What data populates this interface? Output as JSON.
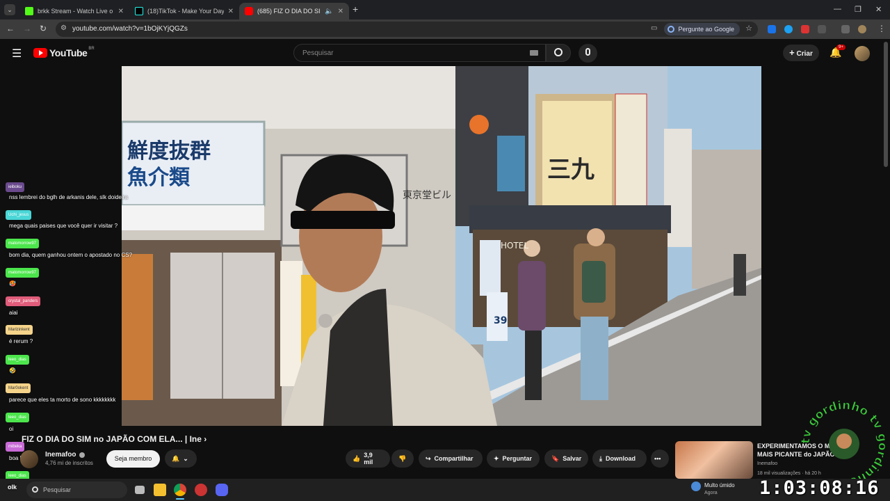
{
  "browser": {
    "tabs": [
      {
        "label": "brkk Stream - Watch Live o",
        "favicon_color": "#53fc18",
        "active": false
      },
      {
        "label": "(18)TikTok - Make Your Day",
        "favicon_color": "#000000",
        "active": false
      },
      {
        "label": "(685) FIZ O DIA DO SIM no",
        "favicon_color": "#ff0000",
        "active": true
      }
    ],
    "new_tab": "+",
    "window_controls": [
      "—",
      "❐",
      "✕"
    ],
    "url": "youtube.com/watch?v=1bOjKYjQGZs",
    "ask_google": "Pergunte ao Google"
  },
  "youtube": {
    "logo_text": "YouTube",
    "region": "BR",
    "search_placeholder": "Pesquisar",
    "create_label": "Criar",
    "notifications": "9+"
  },
  "chat": [
    {
      "user": "ieiboku",
      "color": "#6a4a8c",
      "msg": "nss lembrei do bglh de arkanis dele, slk doideira"
    },
    {
      "user": "Uchi_jesus",
      "color": "#4ad6d6",
      "msg": "mega quais paises que você quer ir visitar ?"
    },
    {
      "user": "matomorrow97",
      "color": "#4ce64c",
      "msg": "bom dia, quem ganhou ontem o apostado no CS?"
    },
    {
      "user": "matomorrow97",
      "color": "#4ce64c",
      "msg": "🥵"
    },
    {
      "user": "crystal_panders",
      "color": "#e05c7a",
      "msg": "aiai"
    },
    {
      "user": "Marlzinkent",
      "color": "#f5d48a",
      "msg": "é rerum ?"
    },
    {
      "user": "leeo_dias",
      "color": "#4ce64c",
      "msg": "🤣"
    },
    {
      "user": "Mar0okent",
      "color": "#f5d48a",
      "msg": "parece que eles ta morto de sono kkkkkkkk"
    },
    {
      "user": "leeo_dias",
      "color": "#4ce64c",
      "msg": "oi"
    },
    {
      "user": "mibeka",
      "color": "#c86ad6",
      "msg": "boa kawa"
    },
    {
      "user": "leeo_dias",
      "color": "#4ce64c",
      "msg": "olk"
    }
  ],
  "video": {
    "title": "FIZ O DIA DO SIM no JAPÃO COM ELA... | Ine ›",
    "sign_left_top": "鮮度抜群",
    "sign_left_bottom": "魚介類",
    "sign_center": "東京堂ビル",
    "sign_main": "三九",
    "sign_hotel": "HOTEL",
    "sign_39": "39"
  },
  "channel": {
    "name": "Inemafoo",
    "subscribers": "4,76 mi de inscritos",
    "join_label": "Seja membro"
  },
  "actions": {
    "likes": "3,9 mil",
    "share": "Compartilhar",
    "ask": "Perguntar",
    "save": "Salvar",
    "download": "Download",
    "more": "•••"
  },
  "recommended": {
    "title": "EXPERIMENTAMOS O MIC... MAIS PICANTE do JAPÃO",
    "channel": "Inemafoo",
    "stats": "18 mil visualizações · há 20 h"
  },
  "watermark": {
    "text": "tv gordinho tv gordinho"
  },
  "taskbar": {
    "start": "olk",
    "search": "Pesquisar",
    "weather": "Multo úmido",
    "weather_sub": "Agora"
  },
  "stream_timer": "1:03:08:16"
}
